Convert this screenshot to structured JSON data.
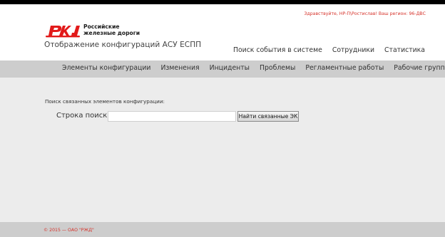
{
  "header": {
    "greeting": "Здравствуйте, НР-П\\Ростислав! Ваш регион: 96-ДВС",
    "logo": {
      "line1": "Российские",
      "line2": "железные дороги",
      "mark_color": "#e21a1a"
    },
    "app_title": "Отображение конфигураций АСУ ЕСПП",
    "nav": [
      {
        "label": "Поиск события в системе"
      },
      {
        "label": "Сотрудники"
      },
      {
        "label": "Статистика"
      }
    ]
  },
  "menu": [
    {
      "label": "Элементы конфигурации"
    },
    {
      "label": "Изменения"
    },
    {
      "label": "Инциденты"
    },
    {
      "label": "Проблемы"
    },
    {
      "label": "Регламентные работы"
    },
    {
      "label": "Рабочие группы"
    }
  ],
  "search": {
    "section_label": "Поиск связанных элементов конфигурации:",
    "label": "Строка поиска:",
    "value": "",
    "button_label": "Найти связанные ЭК"
  },
  "footer": {
    "copyright": "© 2015 — ОАО \"РЖД\""
  },
  "colors": {
    "accent": "#d6322a",
    "menu_bg": "#cdcdcd",
    "page_bg": "#ececec"
  }
}
